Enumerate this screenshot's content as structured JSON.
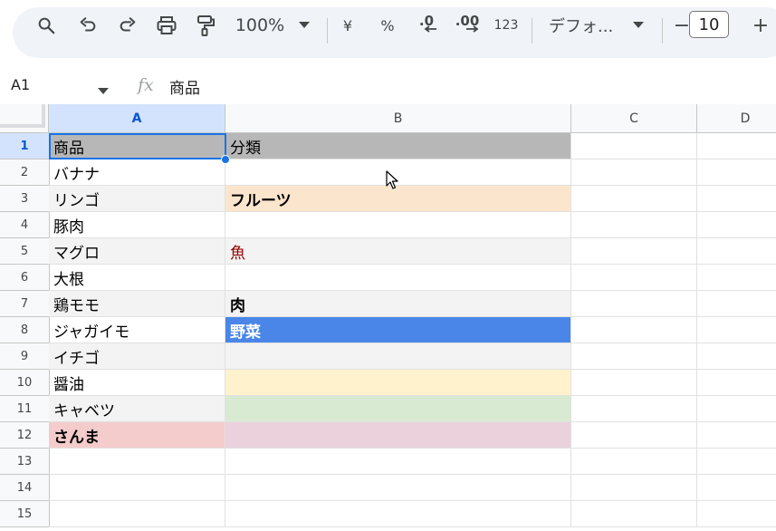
{
  "toolbar": {
    "zoom": "100%",
    "currency": "¥",
    "percent": "%",
    "dec_decrease": ".0",
    "dec_increase": ".00",
    "number_format": "123",
    "font": "デフォ...",
    "font_size": "10",
    "minus": "−",
    "plus": "+"
  },
  "formula_bar": {
    "name_box": "A1",
    "fx": "fx",
    "content": "商品"
  },
  "columns": [
    "A",
    "B",
    "C",
    "D"
  ],
  "rows": [
    "1",
    "2",
    "3",
    "4",
    "5",
    "6",
    "7",
    "8",
    "9",
    "10",
    "11",
    "12",
    "13",
    "14",
    "15"
  ],
  "cells_a": [
    "商品",
    "バナナ",
    "リンゴ",
    "豚肉",
    "マグロ",
    "大根",
    "鶏モモ",
    "ジャガイモ",
    "イチゴ",
    "醤油",
    "キャベツ",
    "さんま",
    "",
    "",
    ""
  ],
  "cells_b": [
    "分類",
    "",
    "フルーツ",
    "",
    "魚",
    "",
    "肉",
    "野菜",
    "",
    "",
    "",
    "",
    "",
    "",
    ""
  ],
  "colors": {
    "header_row": "#b7b7b7",
    "band_gray": "#f3f3f3",
    "fruit_orange": "#fce5cd",
    "fish_text": "#990000",
    "vegetable_blue": "#4a86e8",
    "soy_yellow": "#fff2cc",
    "cabbage_green": "#d9ead3",
    "sanma_red": "#f4cccc",
    "sanma_pink": "#ead1dc",
    "selection": "#1a73e8"
  }
}
